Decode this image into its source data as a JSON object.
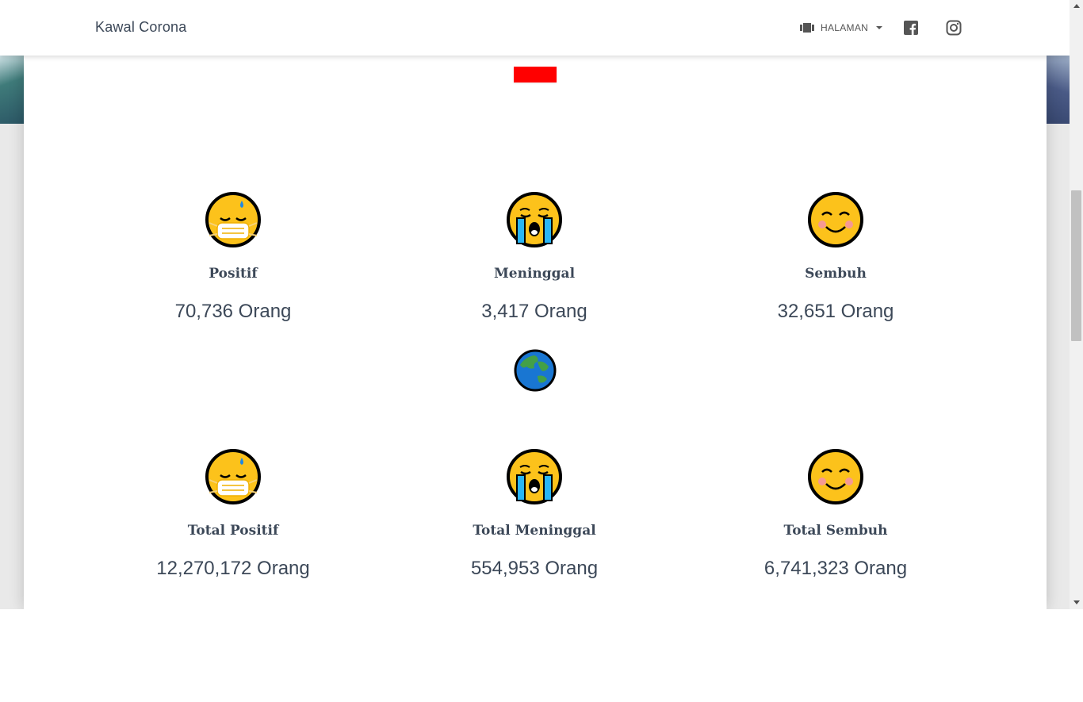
{
  "nav": {
    "brand": "Kawal Corona",
    "menu_label": "HALAMAN",
    "menu_icon": "view-carousel-icon",
    "social": [
      "facebook-icon",
      "instagram-icon"
    ]
  },
  "colors": {
    "flag_red": "#ff0000",
    "text_dark": "#3c4858"
  },
  "indonesia": [
    {
      "title": "Positif",
      "value": "70,736 Orang",
      "emoji": "face-with-medical-mask-sweat-icon"
    },
    {
      "title": "Meninggal",
      "value": "3,417 Orang",
      "emoji": "loudly-crying-face-icon"
    },
    {
      "title": "Sembuh",
      "value": "32,651 Orang",
      "emoji": "smiling-face-icon"
    }
  ],
  "global": [
    {
      "title": "Total Positif",
      "value": "12,270,172 Orang",
      "emoji": "face-with-medical-mask-sweat-icon"
    },
    {
      "title": "Total Meninggal",
      "value": "554,953 Orang",
      "emoji": "loudly-crying-face-icon"
    },
    {
      "title": "Total Sembuh",
      "value": "6,741,323 Orang",
      "emoji": "smiling-face-icon"
    }
  ],
  "section_icons": {
    "top": "indonesia-flag-icon",
    "middle": "globe-asia-australia-icon"
  }
}
